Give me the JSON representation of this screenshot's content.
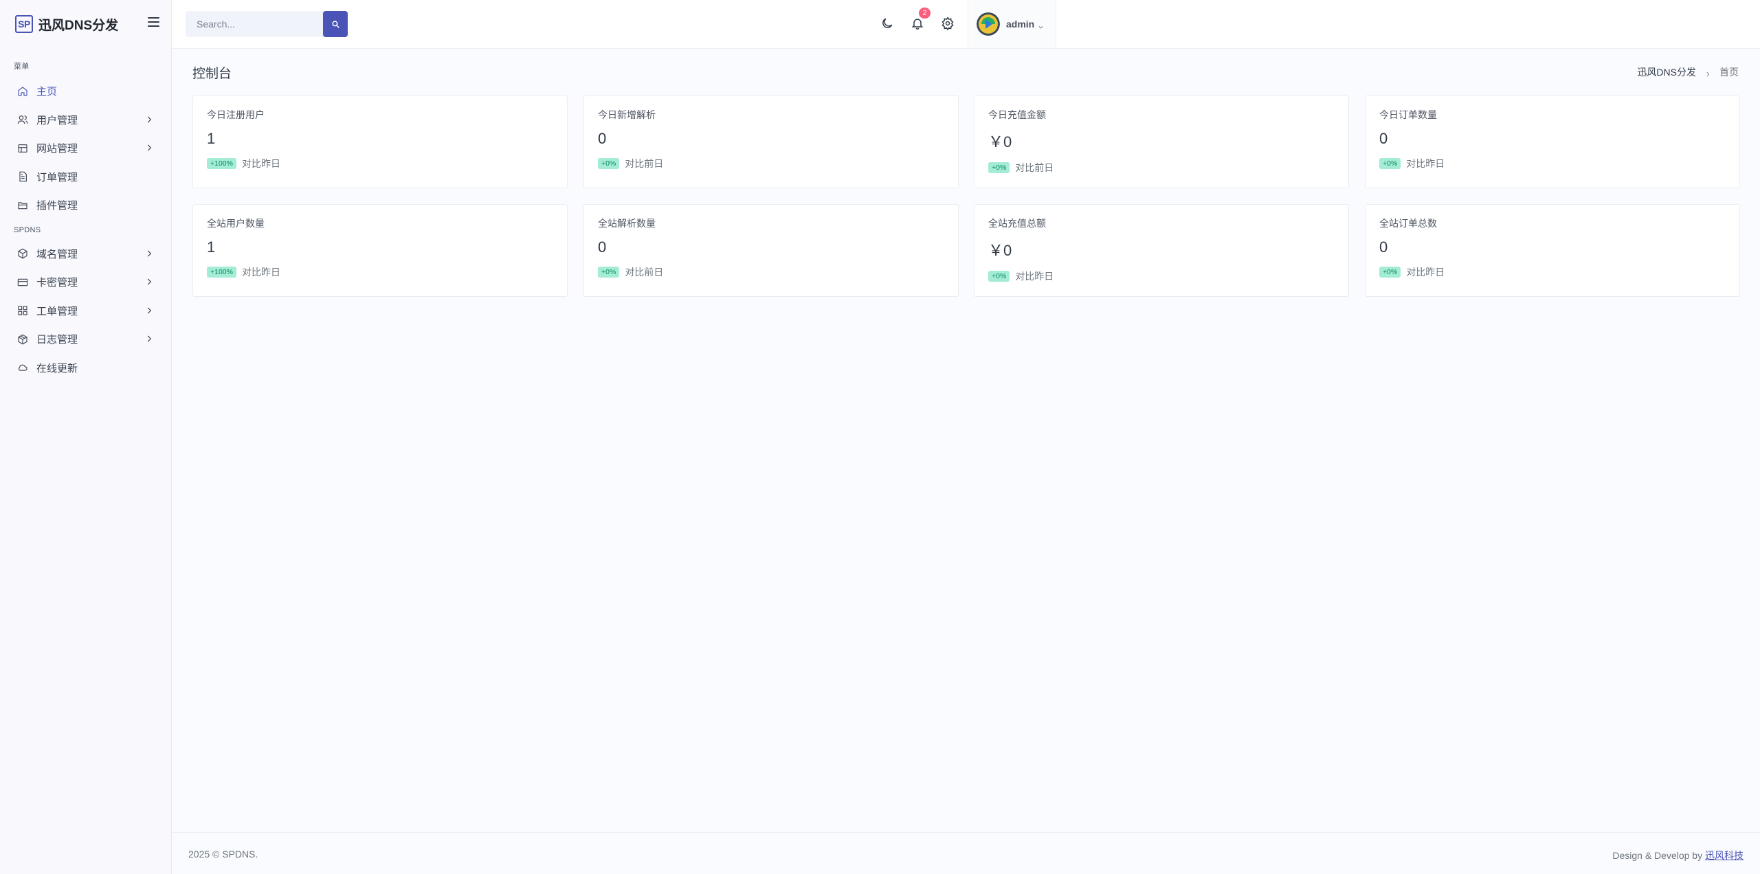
{
  "brand": {
    "logo_text": "SP",
    "name": "迅风DNS分发"
  },
  "sidebar": {
    "sections": [
      {
        "title": "菜单"
      },
      {
        "title": "SPDNS"
      }
    ],
    "items": [
      {
        "label": "主页",
        "icon": "home-icon"
      },
      {
        "label": "用户管理",
        "icon": "users-icon"
      },
      {
        "label": "网站管理",
        "icon": "table-icon"
      },
      {
        "label": "订单管理",
        "icon": "file-text-icon"
      },
      {
        "label": "插件管理",
        "icon": "folder-icon"
      },
      {
        "label": "域名管理",
        "icon": "package-icon"
      },
      {
        "label": "卡密管理",
        "icon": "credit-card-icon"
      },
      {
        "label": "工单管理",
        "icon": "grid-icon"
      },
      {
        "label": "日志管理",
        "icon": "box-icon"
      },
      {
        "label": "在线更新",
        "icon": "cloud-icon"
      }
    ]
  },
  "topbar": {
    "search_placeholder": "Search...",
    "notification_count": "2",
    "username": "admin"
  },
  "page": {
    "title": "控制台",
    "breadcrumb": [
      "迅风DNS分发",
      "首页"
    ]
  },
  "stats": [
    {
      "title": "今日注册用户",
      "value": "1",
      "change": "+100%",
      "compare": "对比昨日"
    },
    {
      "title": "今日新增解析",
      "value": "0",
      "change": "+0%",
      "compare": "对比前日"
    },
    {
      "title": "今日充值金额",
      "value": "￥0",
      "change": "+0%",
      "compare": "对比前日"
    },
    {
      "title": "今日订单数量",
      "value": "0",
      "change": "+0%",
      "compare": "对比昨日"
    },
    {
      "title": "全站用户数量",
      "value": "1",
      "change": "+100%",
      "compare": "对比昨日"
    },
    {
      "title": "全站解析数量",
      "value": "0",
      "change": "+0%",
      "compare": "对比前日"
    },
    {
      "title": "全站充值总额",
      "value": "￥0",
      "change": "+0%",
      "compare": "对比昨日"
    },
    {
      "title": "全站订单总数",
      "value": "0",
      "change": "+0%",
      "compare": "对比昨日"
    }
  ],
  "footer": {
    "copyright": "2025 © SPDNS.",
    "credit_prefix": "Design & Develop by",
    "credit_link": "迅风科技"
  },
  "colors": {
    "accent": "#4a54b6",
    "badge_bg": "#a4ecd5",
    "badge_text": "#0a8a62",
    "notification": "#fa5c7c"
  }
}
